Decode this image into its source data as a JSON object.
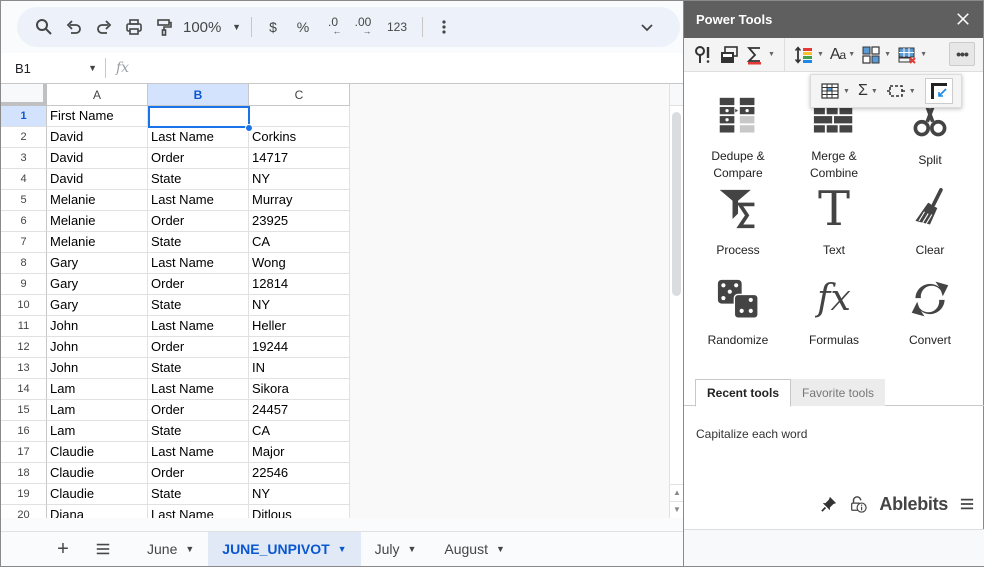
{
  "toolbar": {
    "zoom_level": "100%",
    "currency_label": "$",
    "percent_label": "%",
    "decrease_decimal_label": ".0",
    "increase_decimal_label": ".00",
    "number_format_label": "123"
  },
  "formula_bar": {
    "name_box": "B1",
    "fx_label": "fx",
    "formula_value": ""
  },
  "grid": {
    "columns": [
      "A",
      "B",
      "C"
    ],
    "selected_column": "B",
    "selected_cell": "B1",
    "rows": [
      {
        "num": "1",
        "a": "First Name",
        "b": "",
        "c": ""
      },
      {
        "num": "2",
        "a": "David",
        "b": "Last Name",
        "c": "Corkins"
      },
      {
        "num": "3",
        "a": "David",
        "b": "Order",
        "c": "14717"
      },
      {
        "num": "4",
        "a": "David",
        "b": "State",
        "c": "NY"
      },
      {
        "num": "5",
        "a": "Melanie",
        "b": "Last Name",
        "c": "Murray"
      },
      {
        "num": "6",
        "a": "Melanie",
        "b": "Order",
        "c": "23925"
      },
      {
        "num": "7",
        "a": "Melanie",
        "b": "State",
        "c": "CA"
      },
      {
        "num": "8",
        "a": "Gary",
        "b": "Last Name",
        "c": "Wong"
      },
      {
        "num": "9",
        "a": "Gary",
        "b": "Order",
        "c": "12814"
      },
      {
        "num": "10",
        "a": "Gary",
        "b": "State",
        "c": "NY"
      },
      {
        "num": "11",
        "a": "John",
        "b": "Last Name",
        "c": "Heller"
      },
      {
        "num": "12",
        "a": "John",
        "b": "Order",
        "c": "19244"
      },
      {
        "num": "13",
        "a": "John",
        "b": "State",
        "c": "IN"
      },
      {
        "num": "14",
        "a": "Lam",
        "b": "Last Name",
        "c": "Sikora"
      },
      {
        "num": "15",
        "a": "Lam",
        "b": "Order",
        "c": "24457"
      },
      {
        "num": "16",
        "a": "Lam",
        "b": "State",
        "c": "CA"
      },
      {
        "num": "17",
        "a": "Claudie",
        "b": "Last Name",
        "c": "Major"
      },
      {
        "num": "18",
        "a": "Claudie",
        "b": "Order",
        "c": "22546"
      },
      {
        "num": "19",
        "a": "Claudie",
        "b": "State",
        "c": "NY"
      },
      {
        "num": "20",
        "a": "Diana",
        "b": "Last Name",
        "c": "Ditlous"
      }
    ]
  },
  "sheet_tabs": {
    "items": [
      {
        "label": "June",
        "active": false
      },
      {
        "label": "JUNE_UNPIVOT",
        "active": true
      },
      {
        "label": "July",
        "active": false
      },
      {
        "label": "August",
        "active": false
      }
    ]
  },
  "panel": {
    "title": "Power Tools",
    "tools": [
      {
        "label": "Dedupe &\nCompare",
        "icon": "dedupe-compare-icon"
      },
      {
        "label": "Merge &\nCombine",
        "icon": "merge-combine-icon"
      },
      {
        "label": "Split",
        "icon": "scissors-icon"
      },
      {
        "label": "Process",
        "icon": "funnel-sigma-icon"
      },
      {
        "label": "Text",
        "icon": "text-t-icon"
      },
      {
        "label": "Clear",
        "icon": "broom-icon"
      },
      {
        "label": "Randomize",
        "icon": "dice-icon"
      },
      {
        "label": "Formulas",
        "icon": "fx-icon"
      },
      {
        "label": "Convert",
        "icon": "convert-arrows-icon"
      }
    ],
    "tabs": {
      "recent": "Recent tools",
      "favorite": "Favorite tools"
    },
    "recent_items": [
      "Capitalize each word"
    ],
    "brand": "Ablebits",
    "colors": {
      "title_bar": "#5f5f5f",
      "active_tab_blue": "#0b57d0",
      "selection_blue": "#1a73e8"
    }
  }
}
